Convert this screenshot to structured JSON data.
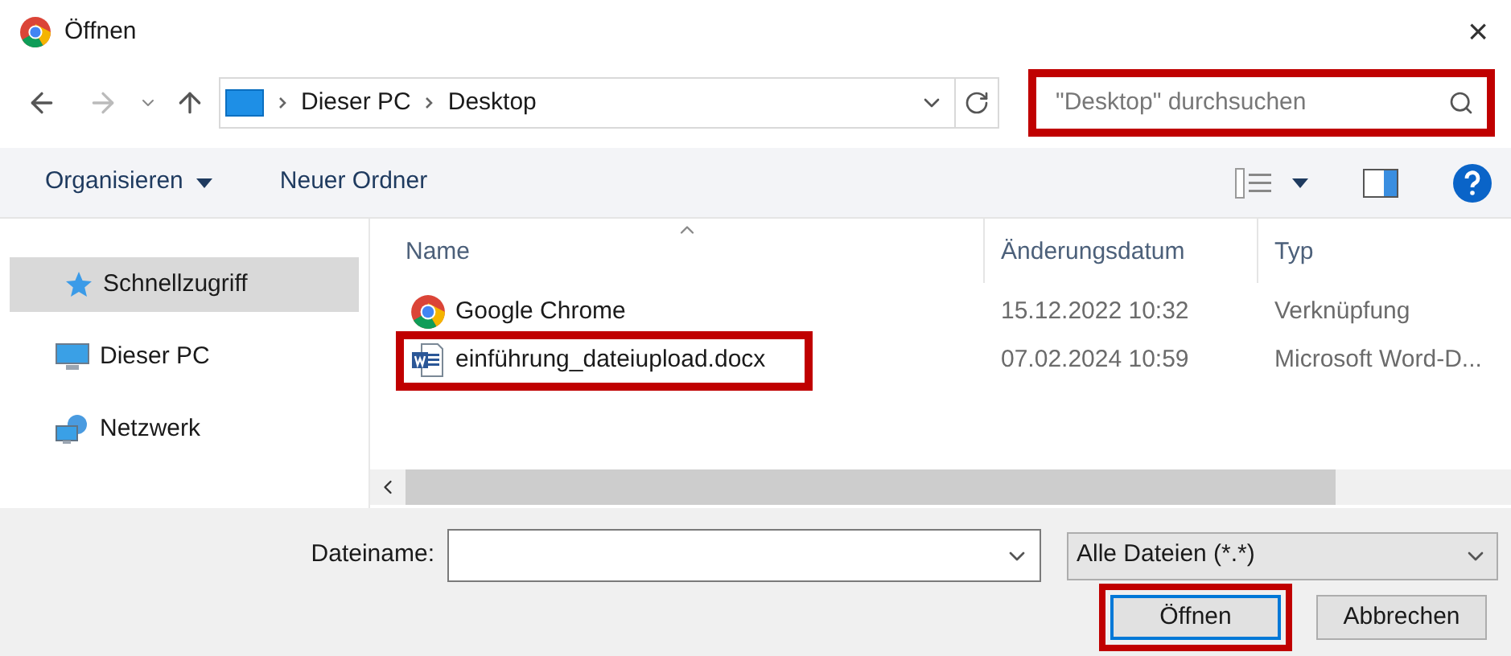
{
  "window": {
    "title": "Öffnen",
    "close": "×"
  },
  "address": {
    "path": [
      {
        "label": "Dieser PC"
      },
      {
        "label": "Desktop"
      }
    ]
  },
  "search": {
    "placeholder": "\"Desktop\" durchsuchen",
    "highlighted": true
  },
  "toolbar": {
    "items": [
      {
        "label": "Organisieren",
        "dropdown": true
      },
      {
        "label": "Neuer Ordner",
        "dropdown": false
      }
    ]
  },
  "sidebar": {
    "items": [
      {
        "label": "Schnellzugriff",
        "kind": "star",
        "selected": true
      },
      {
        "label": "Dieser PC",
        "kind": "pc",
        "selected": false
      },
      {
        "label": "Netzwerk",
        "kind": "network",
        "selected": false
      }
    ]
  },
  "table": {
    "columns": [
      "Name",
      "Änderungsdatum",
      "Typ"
    ],
    "rows": [
      {
        "name": "Google Chrome",
        "kind": "shortcut",
        "date": "15.12.2022 10:32",
        "type": "Verknüpfung",
        "highlighted": false
      },
      {
        "name": "einführung_dateiupload.docx",
        "kind": "word",
        "date": "07.02.2024 10:59",
        "type": "Microsoft Word-D...",
        "highlighted": true
      }
    ]
  },
  "footer": {
    "filename_label": "Dateiname:",
    "filter": "Alle Dateien (*.*)",
    "buttons": [
      {
        "label": "Öffnen",
        "highlighted": true
      },
      {
        "label": "Abbrechen",
        "highlighted": false
      }
    ]
  }
}
